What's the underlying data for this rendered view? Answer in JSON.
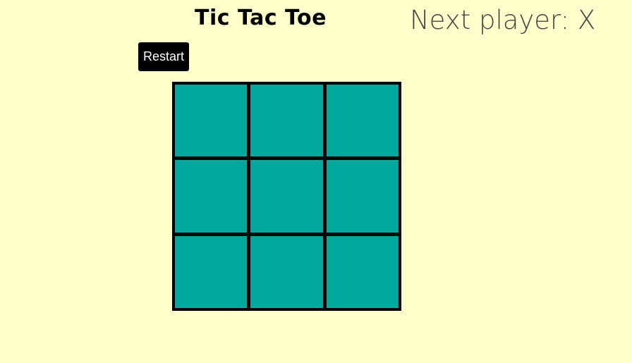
{
  "game": {
    "title": "Tic Tac Toe",
    "status_text": "Next player: X",
    "restart_label": "Restart",
    "cells": [
      "",
      "",
      "",
      "",
      "",
      "",
      "",
      "",
      ""
    ]
  },
  "colors": {
    "background": "#ffffcc",
    "cell": "#00a89d",
    "grid": "#000000",
    "button": "#000000",
    "button_text": "#ffffff",
    "status_text": "#444444"
  }
}
